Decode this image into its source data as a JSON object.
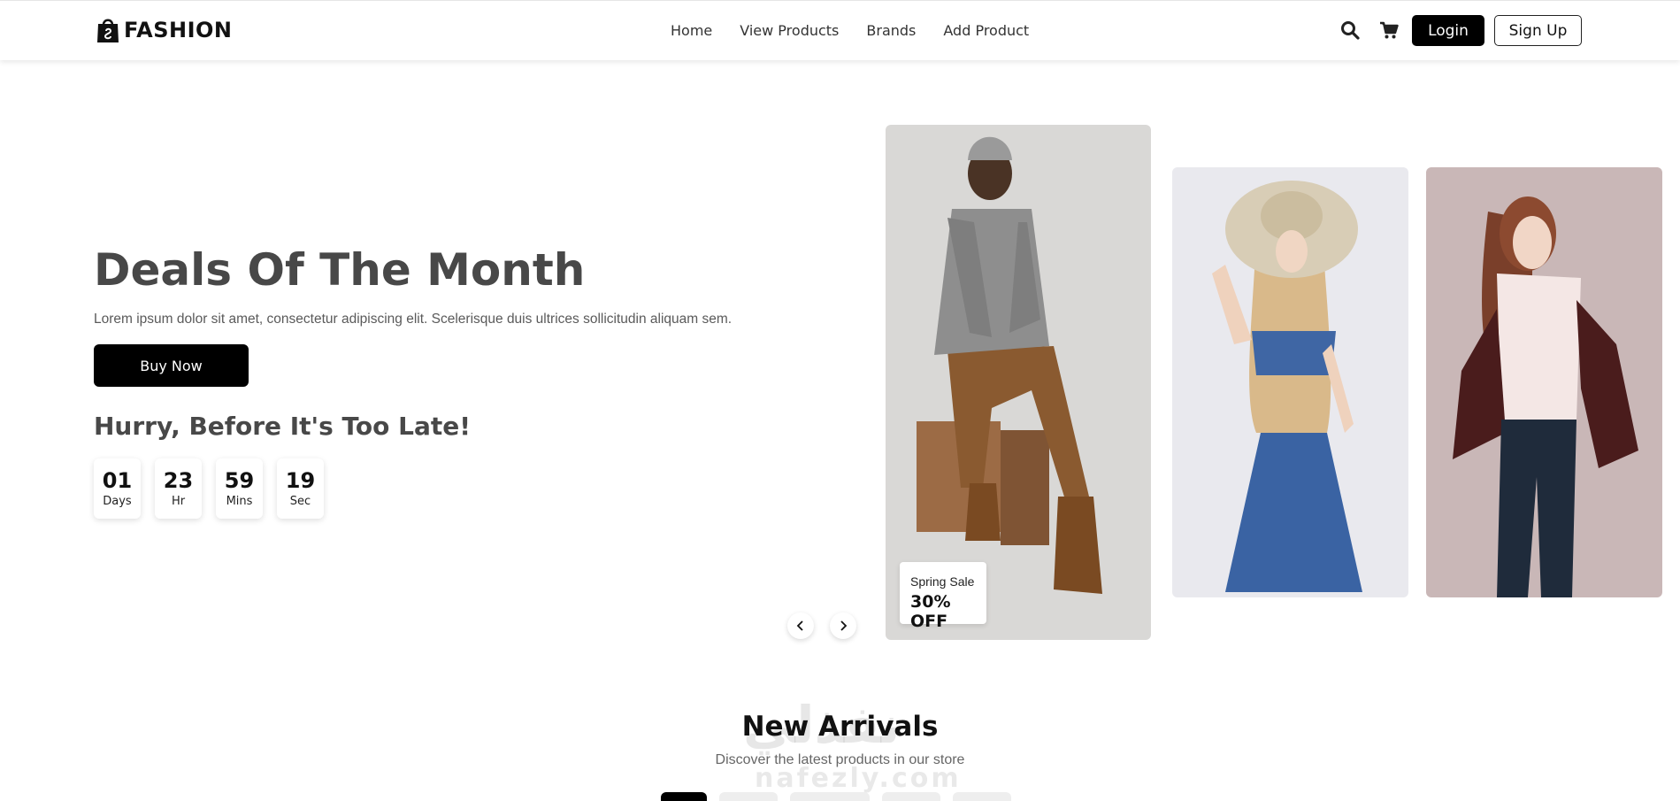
{
  "header": {
    "brand": "FASHION",
    "nav": [
      "Home",
      "View Products",
      "Brands",
      "Add Product"
    ],
    "icons": [
      "search-icon",
      "cart-icon"
    ],
    "login_label": "Login",
    "signup_label": "Sign Up"
  },
  "hero": {
    "title": "Deals Of The Month",
    "text": "Lorem ipsum dolor sit amet, consectetur adipiscing elit. Scelerisque duis ultrices sollicitudin aliquam sem.",
    "buy_label": "Buy Now",
    "hurry": "Hurry, Before It's Too Late!",
    "countdown": [
      {
        "value": "01",
        "unit": "Days"
      },
      {
        "value": "23",
        "unit": "Hr"
      },
      {
        "value": "59",
        "unit": "Mins"
      },
      {
        "value": "19",
        "unit": "Sec"
      }
    ]
  },
  "slider": {
    "sale_label": "Spring Sale",
    "sale_off": "30% OFF",
    "slides": [
      "man in grey sweater sitting on box",
      "woman in sun hat and denim dress",
      "woman in white top and maroon jacket"
    ]
  },
  "new_arrivals": {
    "title": "New Arrivals",
    "subtitle": "Discover the latest products in our store"
  },
  "watermark": {
    "arabic": "نفذلي",
    "latin": "nafezly.com"
  },
  "colors": {
    "accent": "#000000",
    "title": "#484848"
  }
}
